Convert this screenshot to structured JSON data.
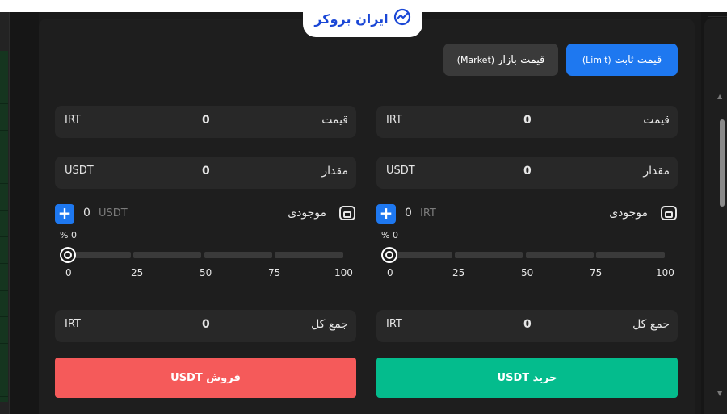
{
  "brand": {
    "name": "ایران بروکر",
    "color": "#1a47d6"
  },
  "tabs": {
    "limit": {
      "label": "قیمت ثابت",
      "sub": "(Limit)",
      "active": true
    },
    "market": {
      "label": "قیمت بازار",
      "sub": "(Market)",
      "active": false
    }
  },
  "buy": {
    "price": {
      "label": "قیمت",
      "value": "0",
      "unit": "IRT"
    },
    "amount": {
      "label": "مقدار",
      "value": "0",
      "unit": "USDT"
    },
    "balance": {
      "label": "موجودی",
      "value": "0",
      "currency": "IRT"
    },
    "percent": {
      "value": "0",
      "sign": "%"
    },
    "slider_ticks": [
      "0",
      "25",
      "50",
      "75",
      "100"
    ],
    "total": {
      "label": "جمع کل",
      "value": "0",
      "unit": "IRT"
    },
    "button": "خرید USDT"
  },
  "sell": {
    "price": {
      "label": "قیمت",
      "value": "0",
      "unit": "IRT"
    },
    "amount": {
      "label": "مقدار",
      "value": "0",
      "unit": "USDT"
    },
    "balance": {
      "label": "موجودی",
      "value": "0",
      "currency": "USDT"
    },
    "percent": {
      "value": "0",
      "sign": "%"
    },
    "slider_ticks": [
      "0",
      "25",
      "50",
      "75",
      "100"
    ],
    "total": {
      "label": "جمع کل",
      "value": "0",
      "unit": "IRT"
    },
    "button": "فروش USDT"
  },
  "colors": {
    "accent": "#1e78f0",
    "buy": "#04bc8d",
    "sell": "#f55a5a",
    "panel": "#1e1e1e",
    "field": "#282828"
  },
  "icons": {
    "brand": "chart-trend-icon",
    "wallet": "wallet-icon",
    "plus": "plus-icon"
  }
}
